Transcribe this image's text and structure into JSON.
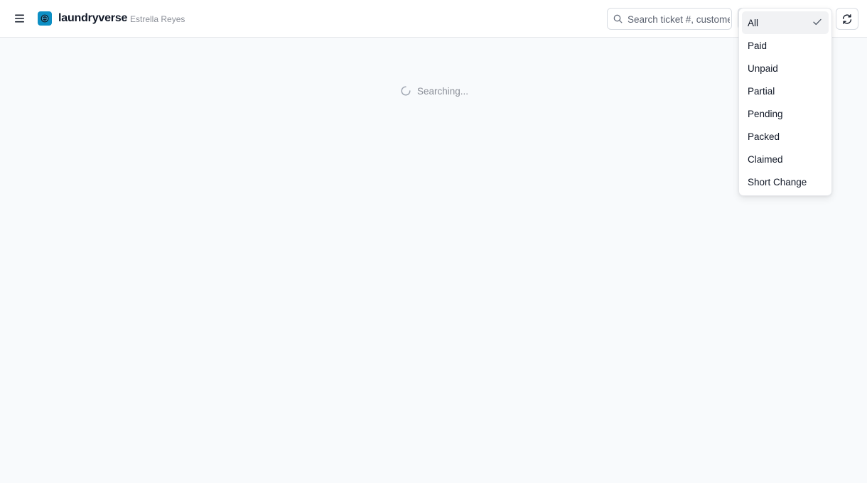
{
  "header": {
    "brand": "laundryverse",
    "user": "Estrella Reyes",
    "search_placeholder": "Search ticket #, customer",
    "refresh_icon": "refresh-icon",
    "menu_icon": "hamburger-icon",
    "logo_icon": "laundry-logo-icon"
  },
  "status": {
    "loading_text": "Searching..."
  },
  "filter": {
    "selected": "All",
    "options": [
      {
        "label": "All"
      },
      {
        "label": "Paid"
      },
      {
        "label": "Unpaid"
      },
      {
        "label": "Partial"
      },
      {
        "label": "Pending"
      },
      {
        "label": "Packed"
      },
      {
        "label": "Claimed"
      },
      {
        "label": "Short Change"
      }
    ]
  },
  "colors": {
    "brand": "#0d8fc4",
    "background": "#f8fafc",
    "muted_text": "#8b8f98"
  }
}
